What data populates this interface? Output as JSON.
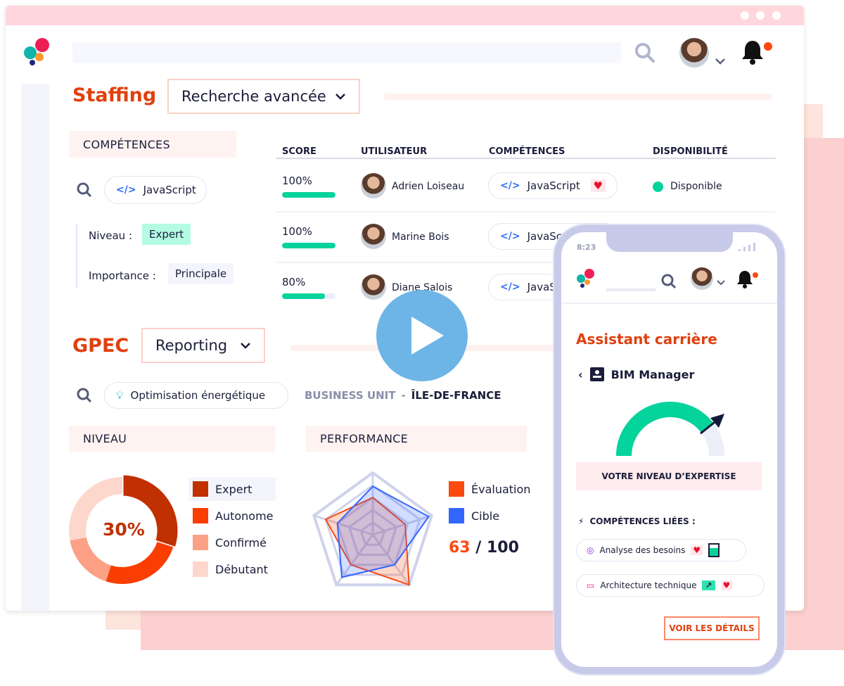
{
  "staffing": {
    "title": "Staffing",
    "dropdown": "Recherche avancée",
    "competences_header": "COMPÉTENCES",
    "skill_chip": "JavaScript",
    "niveau_label": "Niveau :",
    "niveau_value": "Expert",
    "importance_label": "Importance :",
    "importance_value": "Principale",
    "table": {
      "headers": [
        "SCORE",
        "UTILISATEUR",
        "COMPÉTENCES",
        "DISPONIBILITÉ"
      ],
      "rows": [
        {
          "score": "100%",
          "score_value": 100,
          "user": "Adrien Loiseau",
          "skill": "JavaScript",
          "availability": "Disponible"
        },
        {
          "score": "100%",
          "score_value": 100,
          "user": "Marine Bois",
          "skill": "JavaScript"
        },
        {
          "score": "80%",
          "score_value": 80,
          "user": "Diane Salois",
          "skill": "JavaScript"
        }
      ]
    }
  },
  "gpec": {
    "title": "GPEC",
    "dropdown": "Reporting",
    "search_chip": "Optimisation énergétique",
    "business_unit_label": "BUSINESS UNIT",
    "separator": "-",
    "business_unit_value": "ÎLE-DE-FRANCE",
    "niveau_header": "NIVEAU",
    "performance_header": "PERFORMANCE",
    "score": "63",
    "score_total": "/ 100"
  },
  "chart_data": [
    {
      "type": "pie",
      "center_label": "30%",
      "categories": [
        "Expert",
        "Autonome",
        "Confirmé",
        "Débutant"
      ],
      "values": [
        30,
        25,
        17,
        28
      ],
      "colors": [
        "#c03000",
        "#fa3d00",
        "#fca186",
        "#fdd7cc"
      ]
    },
    {
      "type": "radar",
      "series": [
        {
          "name": "Évaluation",
          "color": "#fa4a10",
          "values": [
            0.6,
            0.55,
            1.0,
            0.6,
            0.8
          ]
        },
        {
          "name": "Cible",
          "color": "#3366ff",
          "values": [
            0.78,
            0.95,
            0.6,
            0.85,
            0.6
          ]
        }
      ],
      "rmax": 1
    }
  ],
  "phone": {
    "time": "8:23",
    "title": "Assistant carrière",
    "job": "BIM Manager",
    "gauge_level": 0.8,
    "expertise_label": "VOTRE NIVEAU D’EXPERTISE",
    "related_label": "COMPÉTENCES LIÉES :",
    "skills": [
      "Analyse des besoins",
      "Architecture technique"
    ],
    "details_button": "VOIR LES DÉTAILS"
  },
  "colors": {
    "accent": "#e0400e",
    "green": "#05d39c",
    "blue": "#2e6cf5"
  }
}
